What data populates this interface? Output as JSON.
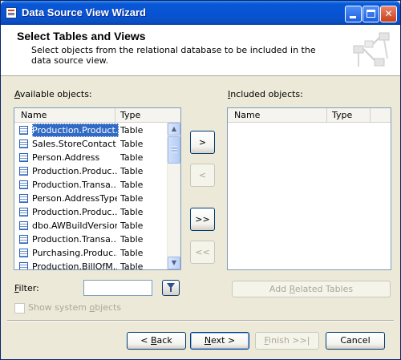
{
  "window": {
    "title": "Data Source View Wizard",
    "controls": {
      "minimize": "minimize",
      "maximize": "maximize",
      "close": "✕"
    }
  },
  "header": {
    "title": "Select Tables and Views",
    "subtitle": "Select objects from the relational database to be included in the data source view."
  },
  "available": {
    "label_prefix": "",
    "label_access": "A",
    "label_rest": "vailable objects:",
    "columns": {
      "name": "Name",
      "type": "Type"
    },
    "rows": [
      {
        "name": "Production.Product...",
        "type": "Table",
        "selected": true
      },
      {
        "name": "Sales.StoreContact",
        "type": "Table"
      },
      {
        "name": "Person.Address",
        "type": "Table"
      },
      {
        "name": "Production.Produc...",
        "type": "Table"
      },
      {
        "name": "Production.Transa...",
        "type": "Table"
      },
      {
        "name": "Person.AddressType",
        "type": "Table"
      },
      {
        "name": "Production.Produc...",
        "type": "Table"
      },
      {
        "name": "dbo.AWBuildVersion",
        "type": "Table"
      },
      {
        "name": "Production.Transa...",
        "type": "Table"
      },
      {
        "name": "Purchasing.Produc...",
        "type": "Table"
      },
      {
        "name": "Production.BillOfM...",
        "type": "Table"
      }
    ]
  },
  "included": {
    "label_prefix": "",
    "label_access": "I",
    "label_rest": "ncluded objects:",
    "columns": {
      "name": "Name",
      "type": "Type"
    }
  },
  "move_buttons": {
    "add": ">",
    "remove": "<",
    "add_all": ">>",
    "remove_all": "<<"
  },
  "filter": {
    "label_access": "F",
    "label_rest": "ilter:",
    "value": ""
  },
  "show_system": {
    "label_pre": "Show system ",
    "label_access": "o",
    "label_post": "bjects",
    "checked": false
  },
  "add_related": {
    "pre": "Add ",
    "access": "R",
    "post": "elated Tables"
  },
  "footer": {
    "back": {
      "pre": "< ",
      "access": "B",
      "post": "ack"
    },
    "next": {
      "access": "N",
      "post": "ext >"
    },
    "finish": {
      "access": "F",
      "post": "inish >>|"
    },
    "cancel": "Cancel"
  }
}
